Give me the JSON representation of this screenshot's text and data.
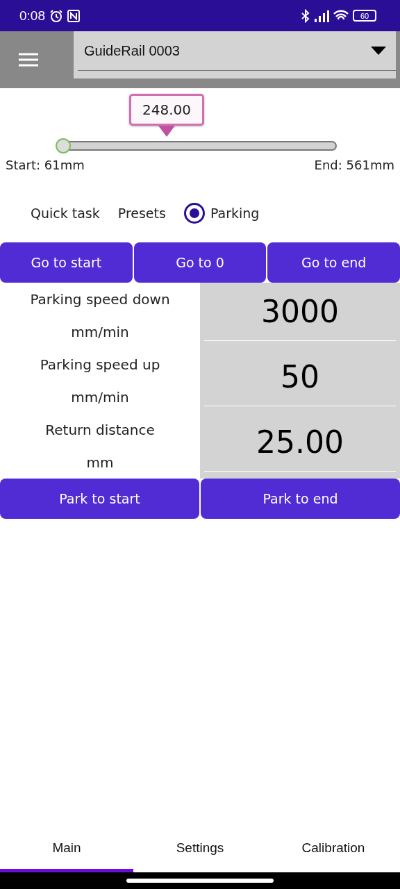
{
  "status_bar": {
    "time": "0:08",
    "battery": "60"
  },
  "header": {
    "device": "GuideRail 0003"
  },
  "slider": {
    "tooltip": "248.00",
    "level": 0,
    "start_label": "Start: 61mm",
    "end_label": "End: 561mm"
  },
  "modes": [
    {
      "label": "Quick task",
      "selected": false
    },
    {
      "label": "Presets",
      "selected": false
    },
    {
      "label": "Parking",
      "selected": true
    }
  ],
  "go_buttons": [
    "Go to start",
    "Go to 0",
    "Go to end"
  ],
  "parameters": [
    {
      "label": "Parking speed down",
      "unit": "mm/min",
      "value": "3000"
    },
    {
      "label": "Parking speed up",
      "unit": "mm/min",
      "value": "50"
    },
    {
      "label": "Return distance",
      "unit": "mm",
      "value": "25.00"
    }
  ],
  "park_buttons": [
    "Park to start",
    "Park to end"
  ],
  "tabs": [
    {
      "label": "Main",
      "selected": true
    },
    {
      "label": "Settings",
      "selected": false
    },
    {
      "label": "Calibration",
      "selected": false
    }
  ]
}
